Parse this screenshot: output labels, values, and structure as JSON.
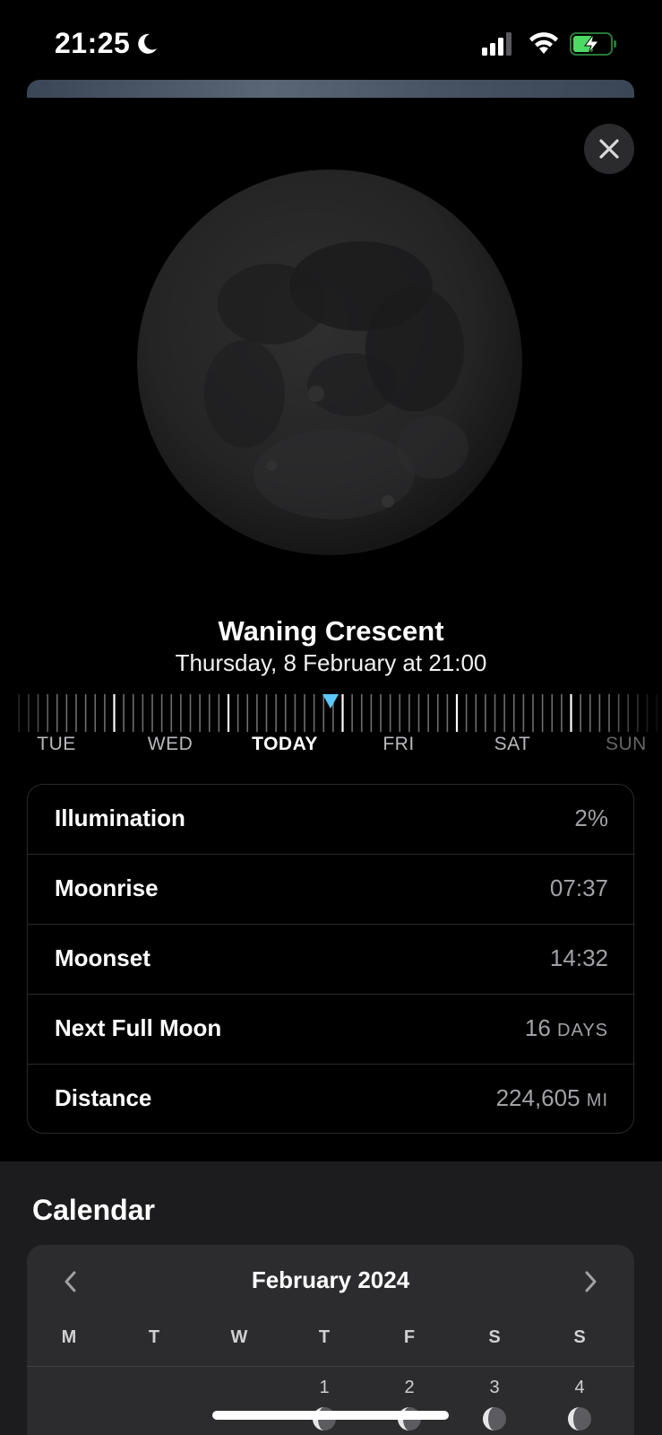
{
  "status_bar": {
    "time": "21:25",
    "focus_icon": "moon-icon",
    "signal_icon": "cellular-signal-icon",
    "wifi_icon": "wifi-icon",
    "battery_icon": "battery-charging-icon",
    "battery_color": "#4cd964"
  },
  "header": {
    "close_icon": "close-icon"
  },
  "moon": {
    "phase_name": "Waning Crescent",
    "date_time": "Thursday, 8 February at 21:00"
  },
  "timeline": {
    "day_labels": [
      "TUE",
      "WED",
      "TODAY",
      "FRI",
      "SAT",
      "SUN"
    ],
    "selected_label": "TODAY",
    "marker_color": "#5ac8fa"
  },
  "info": {
    "rows": [
      {
        "label": "Illumination",
        "value": "2%",
        "unit": ""
      },
      {
        "label": "Moonrise",
        "value": "07:37",
        "unit": ""
      },
      {
        "label": "Moonset",
        "value": "14:32",
        "unit": ""
      },
      {
        "label": "Next Full Moon",
        "value": "16 ",
        "unit": "DAYS"
      },
      {
        "label": "Distance",
        "value": "224,605 ",
        "unit": "MI"
      }
    ]
  },
  "calendar": {
    "title": "Calendar",
    "month": "February 2024",
    "prev_icon": "chevron-left-icon",
    "next_icon": "chevron-right-icon",
    "weekdays": [
      "M",
      "T",
      "W",
      "T",
      "F",
      "S",
      "S"
    ],
    "first_row_days": [
      "",
      "",
      "",
      "1",
      "2",
      "3",
      "4"
    ]
  }
}
